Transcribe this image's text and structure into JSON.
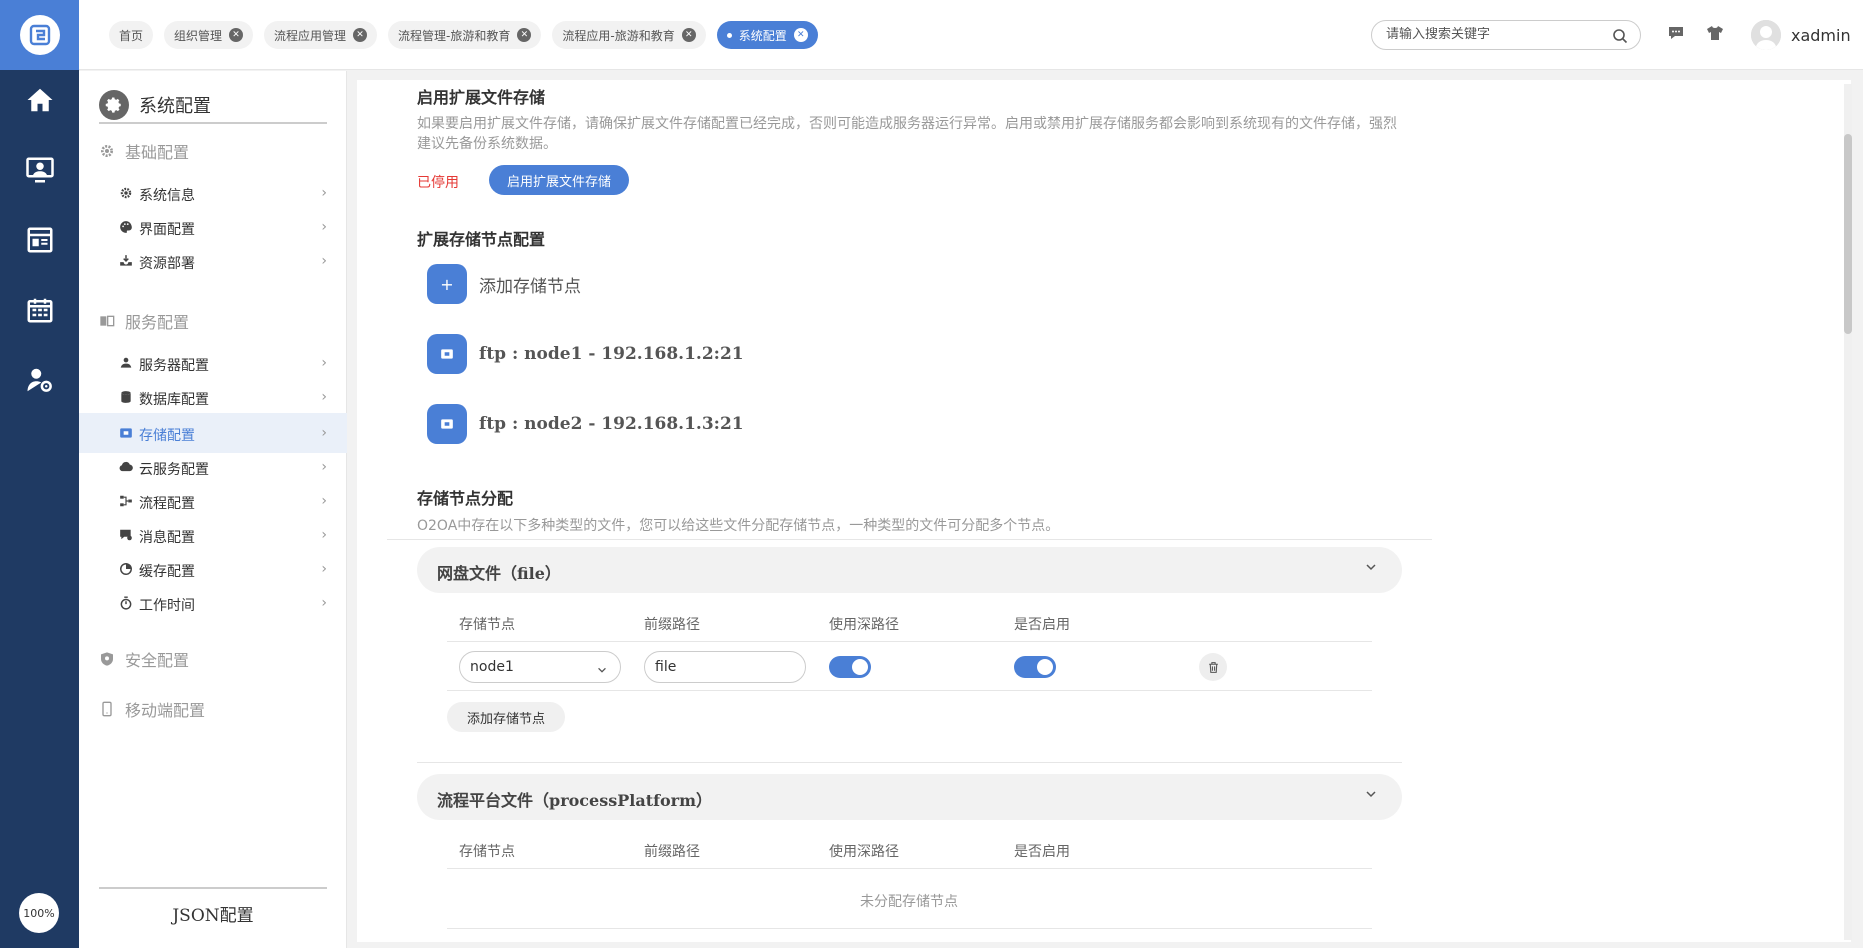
{
  "rail": {
    "zoom": "100%"
  },
  "tabs": [
    {
      "label": "首页"
    },
    {
      "label": "组织管理"
    },
    {
      "label": "流程应用管理"
    },
    {
      "label": "流程管理-旅游和教育"
    },
    {
      "label": "流程应用-旅游和教育"
    },
    {
      "label": "系统配置"
    }
  ],
  "search": {
    "placeholder": "请输入搜索关键字"
  },
  "user": {
    "name": "xadmin"
  },
  "sidenav": {
    "title": "系统配置",
    "groups": {
      "basic": "基础配置",
      "service": "服务配置",
      "security": "安全配置",
      "mobile": "移动端配置"
    },
    "items": {
      "sysinfo": "系统信息",
      "ui": "界面配置",
      "resource": "资源部署",
      "server": "服务器配置",
      "database": "数据库配置",
      "storage": "存储配置",
      "cloud": "云服务配置",
      "process": "流程配置",
      "message": "消息配置",
      "cache": "缓存配置",
      "worktime": "工作时间"
    },
    "footer": "JSON配置"
  },
  "main": {
    "ext": {
      "title": "启用扩展文件存储",
      "desc1": "如果要启用扩展文件存储，请确保扩展文件存储配置已经完成，否则可能造成服务器运行异常。启用或禁用扩展存储服务都会影响到系统现有的文件存储，强烈",
      "desc2": "建议先备份系统数据。",
      "status": "已停用",
      "enable_btn": "启用扩展文件存储"
    },
    "nodes": {
      "title": "扩展存储节点配置",
      "add_label": "添加存储节点",
      "list": [
        {
          "label": "ftp : node1 - 192.168.1.2:21"
        },
        {
          "label": "ftp : node2 - 192.168.1.3:21"
        }
      ]
    },
    "assign": {
      "title": "存储节点分配",
      "desc": "O2OA中存在以下多种类型的文件，您可以给这些文件分配存储节点，一种类型的文件可分配多个节点。",
      "columns": [
        "存储节点",
        "前缀路径",
        "使用深路径",
        "是否启用"
      ],
      "panels": [
        {
          "title": "网盘文件（file）",
          "row": {
            "node": "node1",
            "prefix": "file",
            "deep_path": true,
            "enabled": true
          },
          "add_btn": "添加存储节点"
        },
        {
          "title": "流程平台文件（processPlatform）",
          "empty": "未分配存储节点"
        }
      ]
    }
  },
  "colors": {
    "accent": "#4a7fd6",
    "rail": "#1f3a63",
    "danger": "#e53935"
  }
}
